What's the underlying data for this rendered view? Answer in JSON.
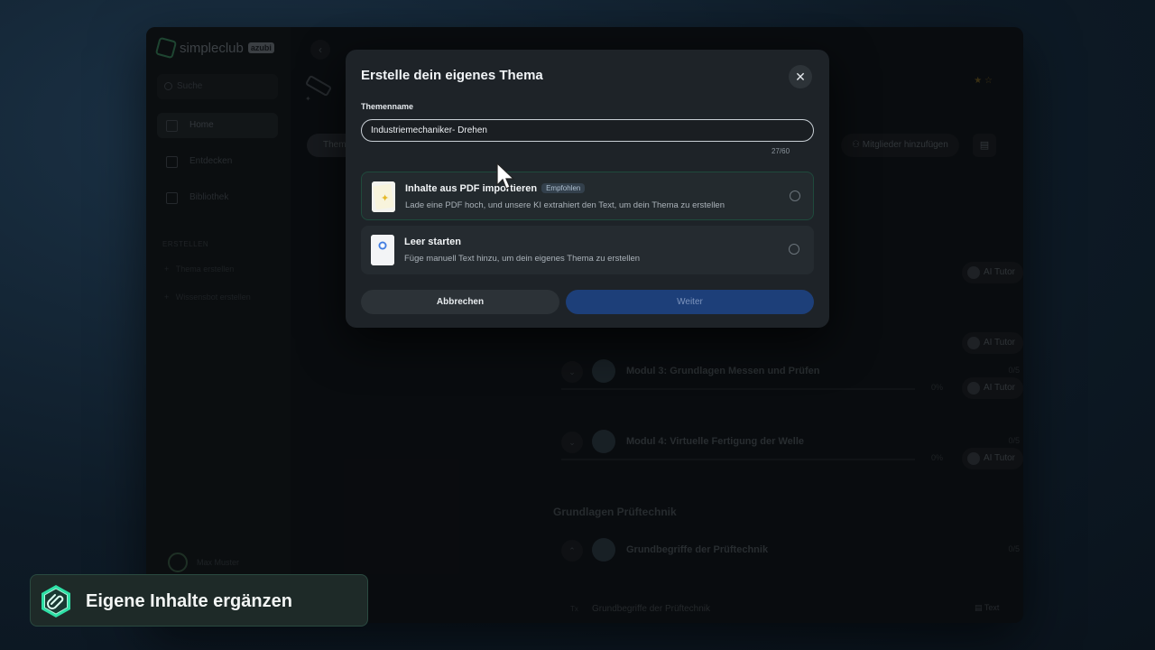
{
  "app": {
    "brand": "simpleclub",
    "brand_badge": "azubi",
    "search_placeholder": "Suche",
    "nav": [
      {
        "label": "Home",
        "icon": "home-icon"
      },
      {
        "label": "Entdecken",
        "icon": "compass-icon"
      },
      {
        "label": "Bibliothek",
        "icon": "library-icon"
      }
    ],
    "section_label": "ERSTELLEN",
    "sidebar_actions": [
      "Thema erstellen",
      "Wissensbot erstellen"
    ],
    "user_name": "Max Muster",
    "tab_label": "Themen",
    "members_button": "Mitglieder hinzufügen",
    "modules": [
      {
        "title": "Modul 3: Grundlagen Messen und Prüfen",
        "count": "0/5",
        "percent": "0%",
        "tutor": "AI Tutor"
      },
      {
        "title": "Modul 4: Virtuelle Fertigung der Welle",
        "count": "0/5",
        "percent": "0%",
        "tutor": "AI Tutor"
      }
    ],
    "extra_tutors": [
      "AI Tutor",
      "AI Tutor"
    ],
    "section_title": "Grundlagen Prüftechnik",
    "section_module": {
      "title": "Grundbegriffe der Prüftechnik",
      "count": "0/5"
    },
    "sub_item": {
      "type_tag": "Tx",
      "title": "Grundbegriffe der Prüftechnik",
      "badge": "Text"
    }
  },
  "modal": {
    "title": "Erstelle dein eigenes Thema",
    "field_label": "Themenname",
    "field_value": "Industriemechaniker- Drehen",
    "counter": "27/60",
    "options": [
      {
        "title": "Inhalte aus PDF importieren",
        "badge": "Empfohlen",
        "description": "Lade eine PDF hoch, und unsere KI extrahiert den Text, um dein Thema zu erstellen",
        "icon": "pdf-document-icon",
        "selected": false
      },
      {
        "title": "Leer starten",
        "description": "Füge manuell Text hinzu, um dein eigenes Thema zu erstellen",
        "icon": "blank-document-icon",
        "selected": false
      }
    ],
    "cancel_label": "Abbrechen",
    "next_label": "Weiter"
  },
  "caption": {
    "text": "Eigene Inhalte ergänzen",
    "icon": "attachment-hexagon-icon"
  },
  "colors": {
    "accent_blue": "#1d3f79",
    "accent_green": "#2ee0a6",
    "modal_bg": "#1e2328"
  }
}
